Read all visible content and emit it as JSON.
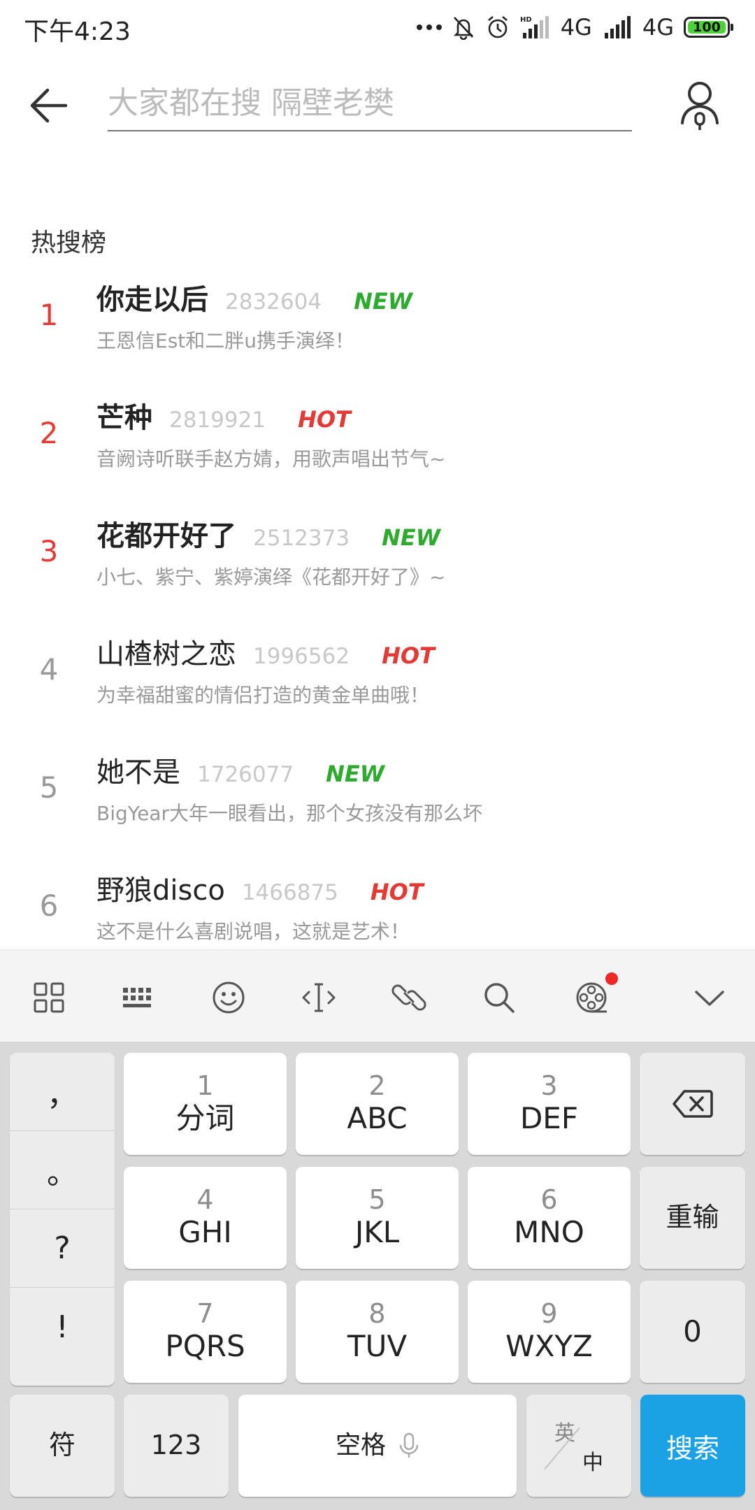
{
  "status_bar": {
    "time": "下午4:23",
    "network_1": "4G",
    "network_2": "4G",
    "battery": "100"
  },
  "search": {
    "placeholder": "大家都在搜 隔壁老樊"
  },
  "hot_list": {
    "title": "热搜榜",
    "items": [
      {
        "rank": "1",
        "title": "你走以后",
        "count": "2832604",
        "tag": "NEW",
        "desc": "王恩信Est和二胖u携手演绎！"
      },
      {
        "rank": "2",
        "title": "芒种",
        "count": "2819921",
        "tag": "HOT",
        "desc": "音阙诗听联手赵方婧，用歌声唱出节气~"
      },
      {
        "rank": "3",
        "title": "花都开好了",
        "count": "2512373",
        "tag": "NEW",
        "desc": "小七、紫宁、紫婷演绎《花都开好了》~"
      },
      {
        "rank": "4",
        "title": "山楂树之恋",
        "count": "1996562",
        "tag": "HOT",
        "desc": "为幸福甜蜜的情侣打造的黄金单曲哦！"
      },
      {
        "rank": "5",
        "title": "她不是",
        "count": "1726077",
        "tag": "NEW",
        "desc": "BigYear大年一眼看出，那个女孩没有那么坏"
      },
      {
        "rank": "6",
        "title": "野狼disco",
        "count": "1466875",
        "tag": "HOT",
        "desc": "这不是什么喜剧说唱，这就是艺术！"
      }
    ]
  },
  "keyboard_toolbar": {
    "icons": [
      "grid-menu-icon",
      "keyboard-icon",
      "emoji-icon",
      "cursor-icon",
      "link-clip-icon",
      "search-icon",
      "film-reel-icon",
      "chevron-down-icon"
    ]
  },
  "keyboard": {
    "punct": [
      "，",
      "。",
      "?",
      "!"
    ],
    "keys": [
      {
        "num": "1",
        "main": "分词"
      },
      {
        "num": "2",
        "main": "ABC"
      },
      {
        "num": "3",
        "main": "DEF"
      },
      {
        "num": "4",
        "main": "GHI"
      },
      {
        "num": "5",
        "main": "JKL"
      },
      {
        "num": "6",
        "main": "MNO"
      },
      {
        "num": "7",
        "main": "PQRS"
      },
      {
        "num": "8",
        "main": "TUV"
      },
      {
        "num": "9",
        "main": "WXYZ"
      }
    ],
    "reenter": "重输",
    "zero": "0",
    "symbol": "符",
    "num123": "123",
    "space": "空格",
    "lang_en": "英",
    "lang_zh": "中",
    "search": "搜索"
  },
  "colors": {
    "rank_top": "#e53935",
    "tag_new": "#2eaa2e",
    "tag_hot": "#e53935",
    "search_key": "#1aa1e6",
    "battery": "#4cd137"
  }
}
